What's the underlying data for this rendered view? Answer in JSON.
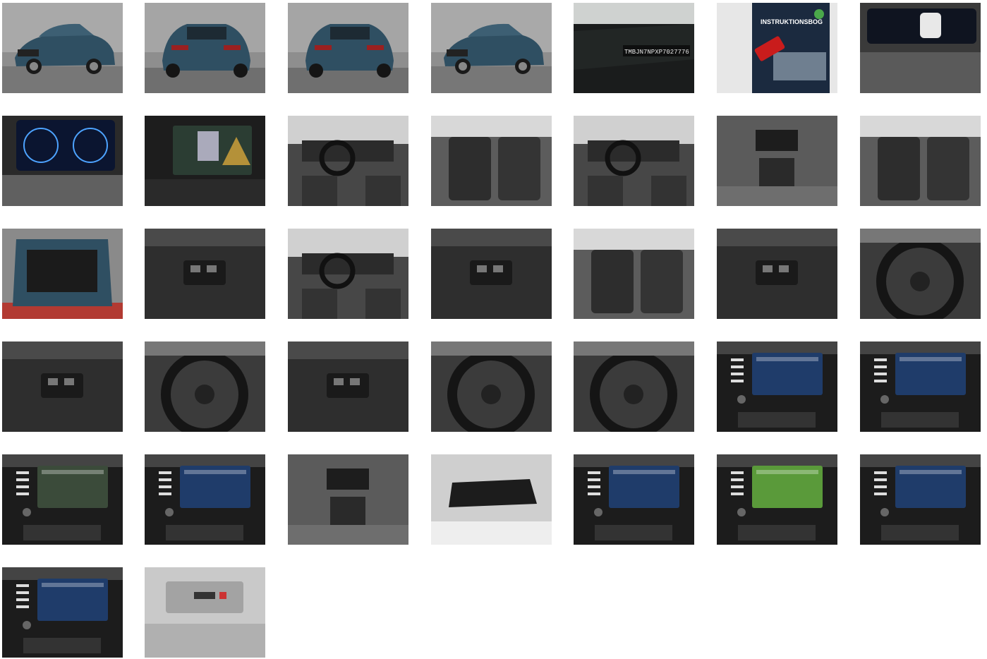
{
  "gallery": {
    "thumbnails": [
      {
        "subject": "exterior-front-left",
        "scene": "car-studio"
      },
      {
        "subject": "exterior-rear-left",
        "scene": "car-studio-rear"
      },
      {
        "subject": "exterior-rear",
        "scene": "car-studio-rear"
      },
      {
        "subject": "exterior-front-right",
        "scene": "car-studio"
      },
      {
        "subject": "vin-plate",
        "scene": "dark-plate",
        "text": "TMBJN7NPXP7027776"
      },
      {
        "subject": "manual-and-key",
        "scene": "booklet",
        "text": "INSTRUKTIONSBOG"
      },
      {
        "subject": "instrument-cluster",
        "scene": "cluster"
      },
      {
        "subject": "digital-cockpit",
        "scene": "cluster-dials"
      },
      {
        "subject": "rear-camera-screen",
        "scene": "infotainment-camera"
      },
      {
        "subject": "front-interior",
        "scene": "cabin"
      },
      {
        "subject": "rear-seats",
        "scene": "seats"
      },
      {
        "subject": "dashboard-overview",
        "scene": "cabin"
      },
      {
        "subject": "rear-air-vents",
        "scene": "console"
      },
      {
        "subject": "seat-controls",
        "scene": "seats"
      },
      {
        "subject": "trunk",
        "scene": "trunk"
      },
      {
        "subject": "tailgate-button",
        "scene": "dark-panel"
      },
      {
        "subject": "driver-cabin",
        "scene": "cabin"
      },
      {
        "subject": "window-switches",
        "scene": "dark-panel"
      },
      {
        "subject": "electric-seat",
        "scene": "seats"
      },
      {
        "subject": "light-switch",
        "scene": "dark-panel"
      },
      {
        "subject": "steering-wheel-buttons",
        "scene": "wheel"
      },
      {
        "subject": "stalk-left",
        "scene": "dark-panel"
      },
      {
        "subject": "stalk-right",
        "scene": "wheel"
      },
      {
        "subject": "wiper-stalk",
        "scene": "dark-panel"
      },
      {
        "subject": "steering-wheel",
        "scene": "wheel"
      },
      {
        "subject": "wheel-buttons-right",
        "scene": "wheel"
      },
      {
        "subject": "infotainment-media",
        "scene": "infotainment"
      },
      {
        "subject": "infotainment-phone",
        "scene": "infotainment"
      },
      {
        "subject": "infotainment-navigation",
        "scene": "infotainment-map"
      },
      {
        "subject": "infotainment-radio",
        "scene": "infotainment"
      },
      {
        "subject": "gear-selector",
        "scene": "console"
      },
      {
        "subject": "rear-view-mirror",
        "scene": "mirror"
      },
      {
        "subject": "infotainment-assist",
        "scene": "infotainment"
      },
      {
        "subject": "infotainment-lane-assist",
        "scene": "infotainment-green"
      },
      {
        "subject": "infotainment-drive-data",
        "scene": "infotainment"
      },
      {
        "subject": "infotainment-message",
        "scene": "infotainment"
      },
      {
        "subject": "roof-console",
        "scene": "roof"
      }
    ]
  },
  "colors": {
    "studio_bg": "#8e8e8e",
    "car_body": "#2f4f62",
    "screen_blue": "#1f3c6a",
    "lane_green": "#5a9a3a",
    "trunk_floor": "#1b1b1b",
    "floor_red": "#b23a32"
  }
}
